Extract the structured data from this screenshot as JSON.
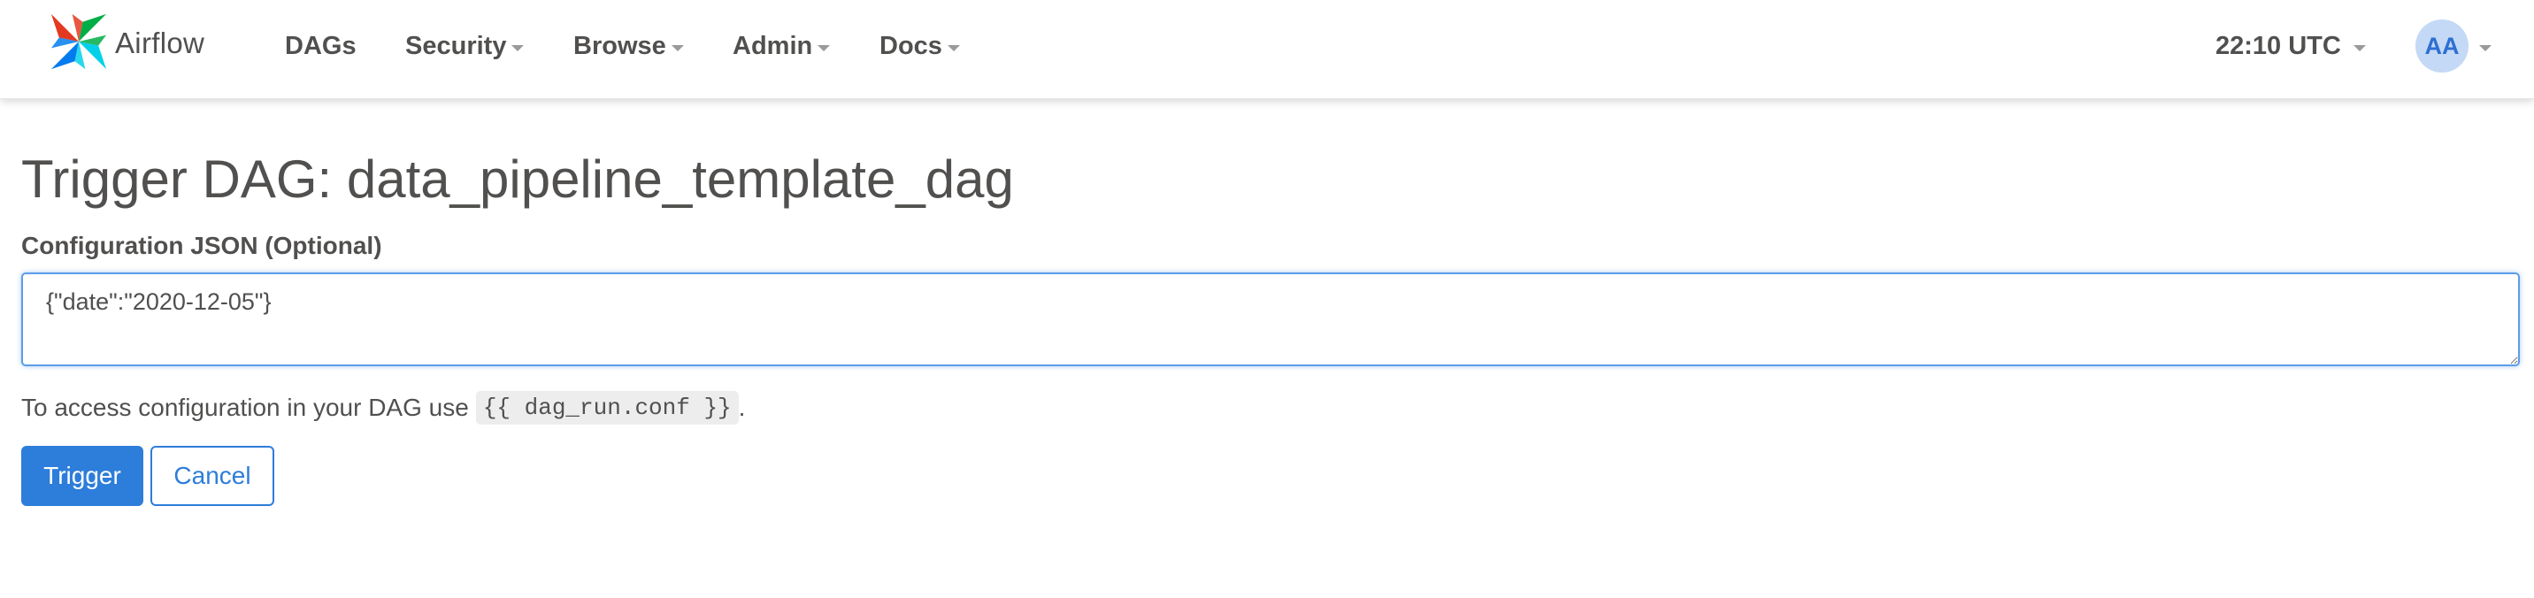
{
  "app": {
    "brand_name": "Airflow",
    "brand_icon": "airflow-pinwheel-icon"
  },
  "nav": {
    "items": [
      {
        "label": "DAGs",
        "has_dropdown": false
      },
      {
        "label": "Security",
        "has_dropdown": true
      },
      {
        "label": "Browse",
        "has_dropdown": true
      },
      {
        "label": "Admin",
        "has_dropdown": true
      },
      {
        "label": "Docs",
        "has_dropdown": true
      }
    ],
    "clock": "22:10 UTC",
    "user_initials": "AA"
  },
  "page": {
    "title": "Trigger DAG: data_pipeline_template_dag",
    "config_label": "Configuration JSON (Optional)",
    "config_value": "{\"date\":\"2020-12-05\"}",
    "help_prefix": "To access configuration in your DAG use",
    "help_code": "{{ dag_run.conf }}",
    "help_suffix": ".",
    "trigger_label": "Trigger",
    "cancel_label": "Cancel"
  },
  "colors": {
    "primary": "#2d7dda",
    "text": "#51504f",
    "avatar_bg": "#c4d9f6",
    "avatar_text": "#2d6fd2",
    "focus_border": "#5c9ce8"
  }
}
